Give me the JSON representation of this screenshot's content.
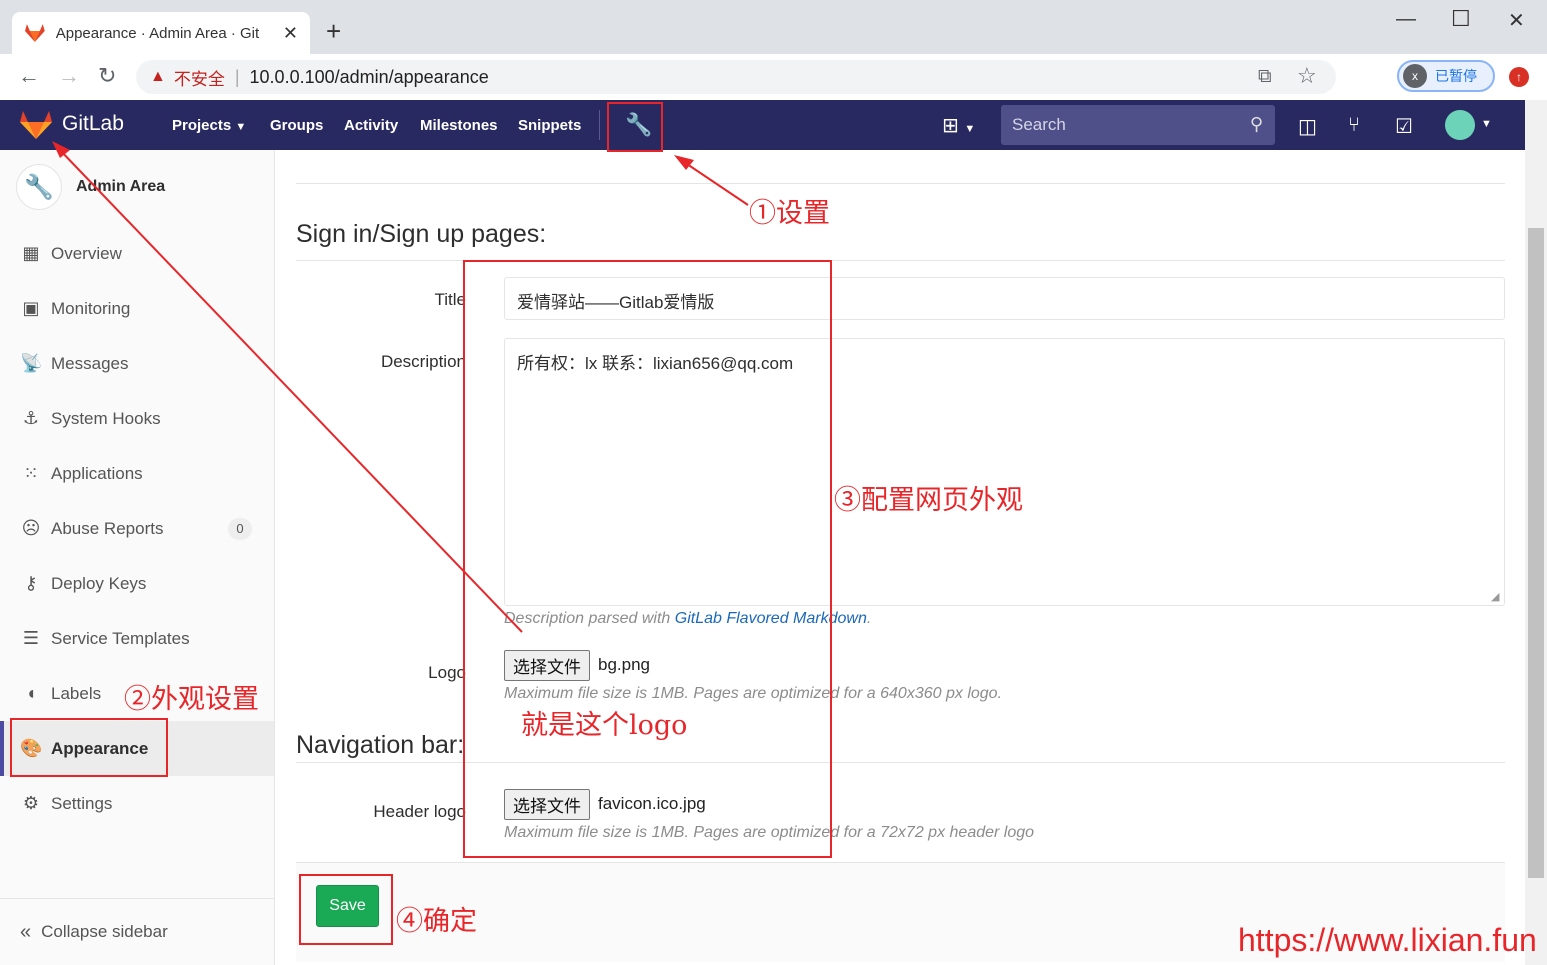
{
  "browser": {
    "tab_title": "Appearance · Admin Area · Git",
    "new_tab": "+",
    "security_label": "不安全",
    "url": "10.0.0.100/admin/appearance",
    "profile_initial": "x",
    "profile_status": "已暂停"
  },
  "header": {
    "brand": "GitLab",
    "nav": [
      "Projects",
      "Groups",
      "Activity",
      "Milestones",
      "Snippets"
    ],
    "search_placeholder": "Search"
  },
  "sidebar": {
    "title": "Admin Area",
    "items": [
      {
        "label": "Overview",
        "icon": "overview-icon"
      },
      {
        "label": "Monitoring",
        "icon": "monitoring-icon"
      },
      {
        "label": "Messages",
        "icon": "messages-icon"
      },
      {
        "label": "System Hooks",
        "icon": "hook-icon"
      },
      {
        "label": "Applications",
        "icon": "applications-icon"
      },
      {
        "label": "Abuse Reports",
        "icon": "abuse-icon",
        "badge": "0"
      },
      {
        "label": "Deploy Keys",
        "icon": "key-icon"
      },
      {
        "label": "Service Templates",
        "icon": "template-icon"
      },
      {
        "label": "Labels",
        "icon": "labels-icon"
      },
      {
        "label": "Appearance",
        "icon": "appearance-icon",
        "active": true
      },
      {
        "label": "Settings",
        "icon": "settings-icon"
      }
    ],
    "collapse_label": "Collapse sidebar"
  },
  "signin": {
    "heading": "Sign in/Sign up pages:",
    "title_label": "Title",
    "title_value": "爱情驿站——Gitlab爱情版",
    "description_label": "Description",
    "description_value": "所有权：lx  联系：lixian656@qq.com",
    "description_hint_prefix": "Description parsed with ",
    "description_hint_link": "GitLab Flavored Markdown",
    "description_hint_suffix": ".",
    "logo_label": "Logo",
    "logo_button": "选择文件",
    "logo_file": "bg.png",
    "logo_hint": "Maximum file size is 1MB. Pages are optimized for a 640x360 px logo."
  },
  "navbar": {
    "heading": "Navigation bar:",
    "header_logo_label": "Header logo",
    "header_logo_button": "选择文件",
    "header_logo_file": "favicon.ico.jpg",
    "header_logo_hint": "Maximum file size is 1MB. Pages are optimized for a 72x72 px header logo"
  },
  "footer": {
    "save_label": "Save"
  },
  "annotations": {
    "step1": "①设置",
    "step2": "②外观设置",
    "step3": "③配置网页外观",
    "step3_note": "就是这个logo",
    "step4": "④确定",
    "color": "#e8262a"
  },
  "watermark": "https://www.lixian.fun",
  "colors": {
    "gitlab_header": "#292961",
    "save_button": "#1aaa55",
    "link": "#1b69b6"
  }
}
